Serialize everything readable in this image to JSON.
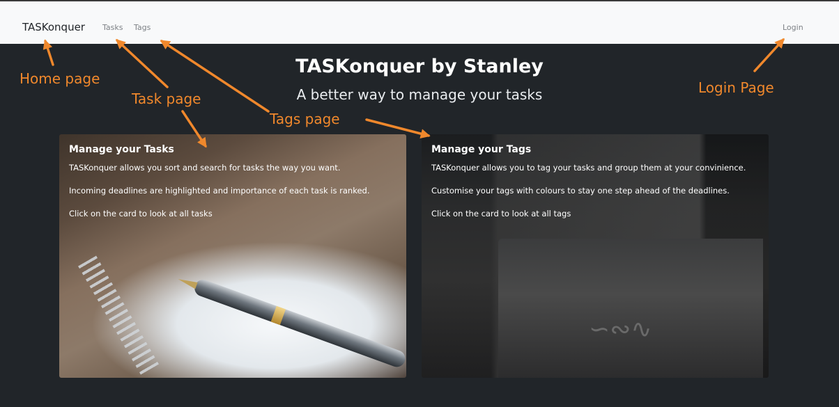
{
  "navbar": {
    "brand": "TASKonquer",
    "links": [
      {
        "label": "Tasks"
      },
      {
        "label": "Tags"
      }
    ],
    "login": "Login"
  },
  "hero": {
    "title": "TASKonquer by Stanley",
    "subtitle": "A better way to manage your tasks"
  },
  "cards": [
    {
      "title": "Manage your Tasks",
      "paragraphs": [
        "TASKonquer allows you sort and search for tasks the way you want.",
        "Incoming deadlines are highlighted and importance of each task is ranked.",
        "Click on the card to look at all tasks"
      ]
    },
    {
      "title": "Manage your Tags",
      "paragraphs": [
        "TASKonquer allows you to tag your tasks and group them at your convinience.",
        "Customise your tags with colours to stay one step ahead of the deadlines.",
        "Click on the card to look at all tags"
      ]
    }
  ],
  "annotations": {
    "home": "Home page",
    "task": "Task page",
    "tags": "Tags page",
    "login": "Login Page"
  },
  "colors": {
    "annotation": "#f0882c",
    "navbar_bg": "#f8f9fa",
    "page_bg": "#212529"
  }
}
